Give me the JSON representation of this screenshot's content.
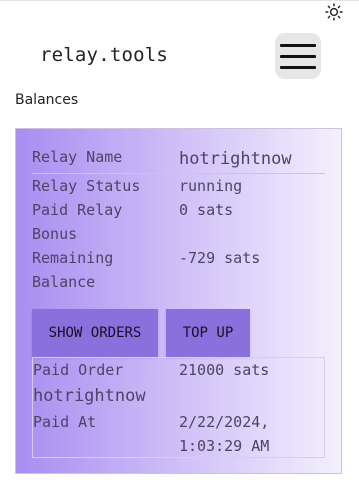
{
  "header": {
    "brand": "relay.tools",
    "theme_icon": "sun-icon",
    "menu_icon": "hamburger-icon"
  },
  "page": {
    "section_title": "Balances"
  },
  "relay": {
    "name_label": "Relay Name",
    "name_value": "hotrightnow",
    "status_label": "Relay Status",
    "status_value": "running",
    "bonus_label_line1": "Paid Relay",
    "bonus_label_line2": "Bonus",
    "bonus_value": "0 sats",
    "remaining_label_line1": "Remaining",
    "remaining_label_line2": "Balance",
    "remaining_value": "-729 sats"
  },
  "actions": {
    "show_orders": "SHOW ORDERS",
    "top_up": "TOP UP"
  },
  "order": {
    "paid_order_label": "Paid Order",
    "paid_order_value": "21000 sats",
    "relay_name": "hotrightnow",
    "paid_at_label": "Paid At",
    "paid_at_line1": "2/22/2024,",
    "paid_at_line2": "1:03:29 AM"
  },
  "colors": {
    "card_gradient_start": "#a98df1",
    "card_gradient_end": "#f4f0fd",
    "button_bg": "#8a70dc",
    "text": "#4c4466"
  }
}
